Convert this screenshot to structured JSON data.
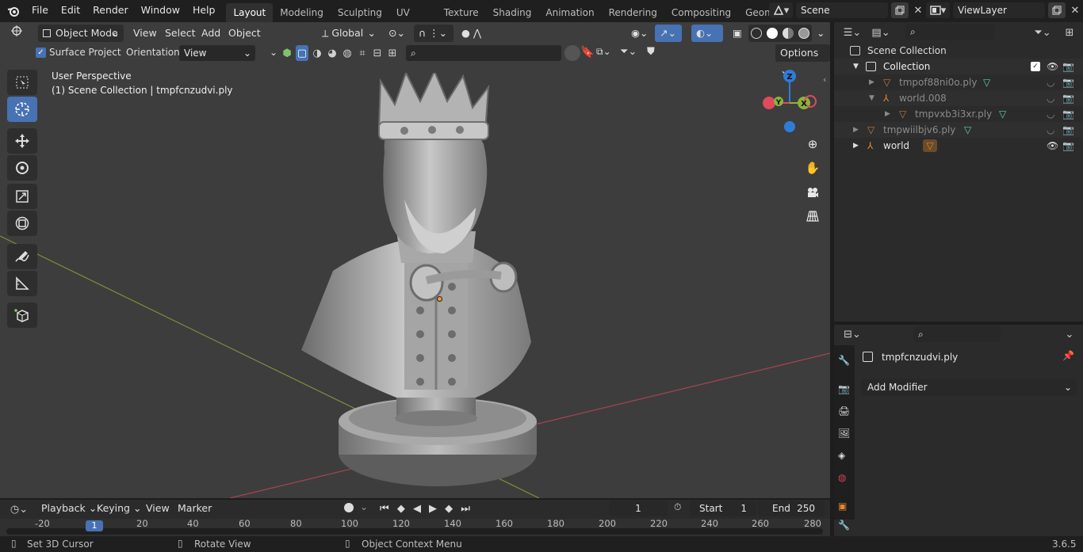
{
  "topbar": {
    "menus": [
      "File",
      "Edit",
      "Render",
      "Window",
      "Help"
    ],
    "workspaces": [
      "Layout",
      "Modeling",
      "Sculpting",
      "UV Editing",
      "Texture Paint",
      "Shading",
      "Animation",
      "Rendering",
      "Compositing",
      "Geometry Noc"
    ],
    "active_workspace": "Layout",
    "scene": "Scene",
    "view_layer": "ViewLayer"
  },
  "viewport_header": {
    "mode": "Object Mode",
    "menus": [
      "View",
      "Select",
      "Add",
      "Object"
    ],
    "transform_orientation": "Global",
    "surface_project_label": "Surface Project",
    "orientation_label": "Orientation:",
    "orientation_value": "View",
    "options_label": "Options"
  },
  "viewport": {
    "perspective_text": "User Perspective",
    "context_text": "(1) Scene Collection | tmpfcnzudvi.ply",
    "gizmo_axes": [
      "X",
      "Y",
      "Z"
    ]
  },
  "outliner": {
    "rows": [
      {
        "label": "Scene Collection",
        "depth": 0
      },
      {
        "label": "Collection",
        "depth": 1
      },
      {
        "label": "tmpof88ni0o.ply",
        "depth": 2
      },
      {
        "label": "world.008",
        "depth": 2
      },
      {
        "label": "tmpvxb3i3xr.ply",
        "depth": 3
      },
      {
        "label": "tmpwiilbjv6.ply",
        "depth": 1
      },
      {
        "label": "world",
        "depth": 1
      }
    ]
  },
  "properties": {
    "object_name": "tmpfcnzudvi.ply",
    "add_modifier_label": "Add Modifier"
  },
  "timeline": {
    "menus": [
      "Playback",
      "Keying",
      "View",
      "Marker"
    ],
    "current_frame": "1",
    "start_label": "Start",
    "start_value": "1",
    "end_label": "End",
    "end_value": "250",
    "ticks": [
      "-20",
      "20",
      "40",
      "60",
      "80",
      "100",
      "120",
      "140",
      "160",
      "180",
      "200",
      "220",
      "240",
      "260",
      "280"
    ],
    "playhead_label": "1"
  },
  "statusbar": {
    "left_hint": "Set 3D Cursor",
    "middle_hint": "Rotate View",
    "right_hint": "Object Context Menu",
    "version": "3.6.5"
  },
  "colors": {
    "accent": "#4772b3",
    "x_axis": "#e04a5a",
    "y_axis": "#8bb33b",
    "z_axis": "#2f7cd8",
    "viewport_bg": "#3d3d3d",
    "mesh_icon": "#5fd4a8",
    "empty_icon": "#e0892e"
  }
}
